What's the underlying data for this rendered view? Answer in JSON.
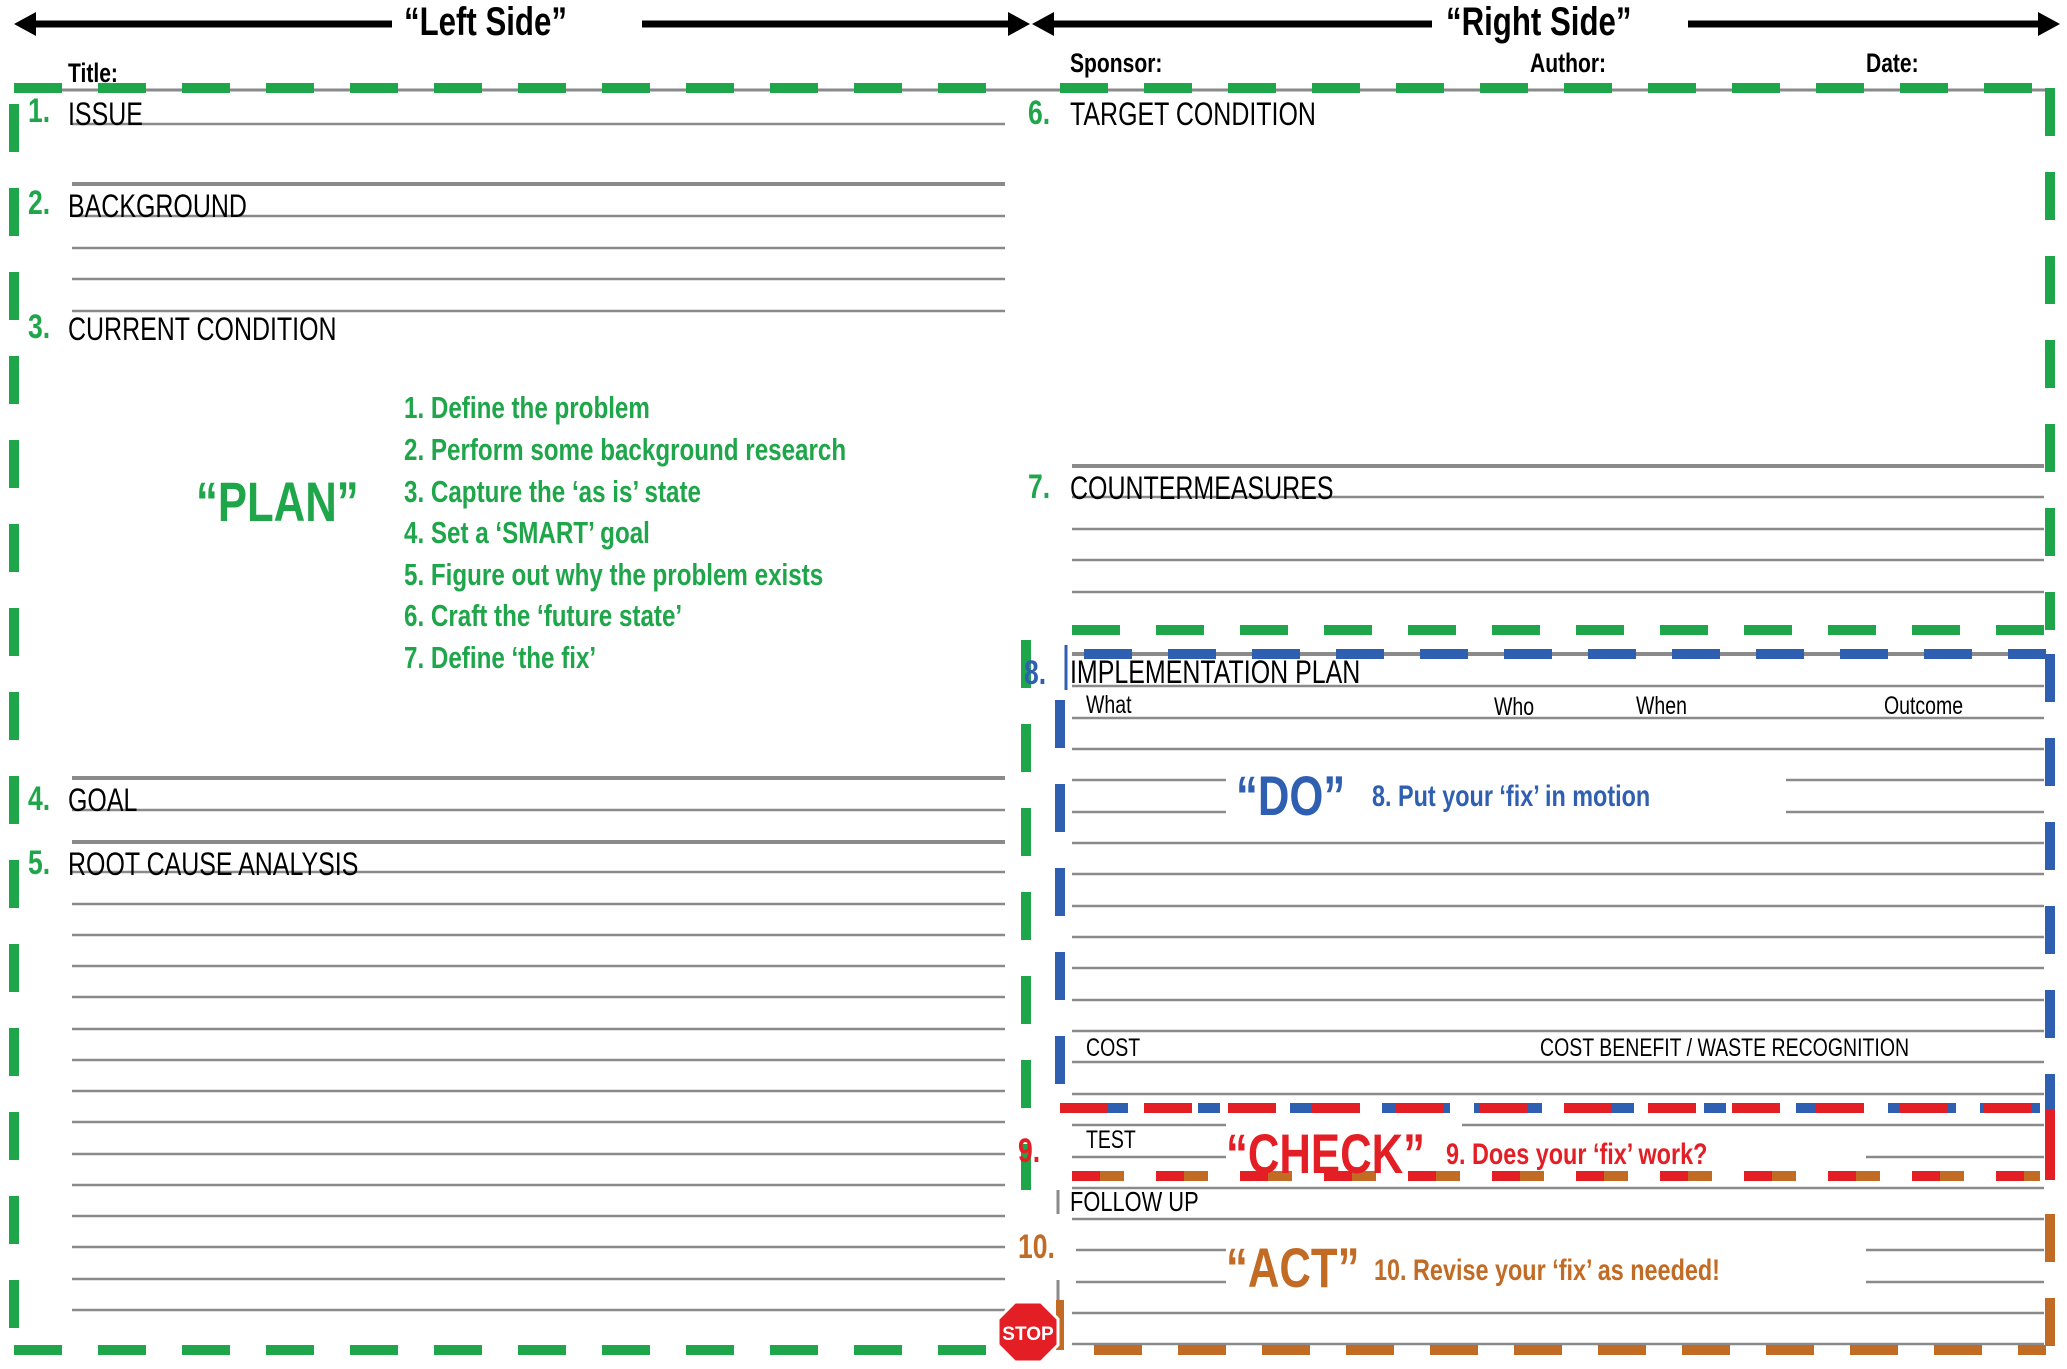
{
  "header": {
    "left_side_title": "“Left Side”",
    "right_side_title": "“Right Side”",
    "title_label": "Title:",
    "sponsor_label": "Sponsor:",
    "author_label": "Author:",
    "date_label": "Date:"
  },
  "colors": {
    "plan": "#1fa64a",
    "do": "#2f5fb0",
    "check": "#e31e24",
    "act": "#c26b25",
    "rule": "#8a8a8a",
    "text": "#000000"
  },
  "sections": [
    {
      "number": "1.",
      "label": "ISSUE",
      "phase": "plan"
    },
    {
      "number": "2.",
      "label": "BACKGROUND",
      "phase": "plan"
    },
    {
      "number": "3.",
      "label": "CURRENT CONDITION",
      "phase": "plan"
    },
    {
      "number": "4.",
      "label": "GOAL",
      "phase": "plan"
    },
    {
      "number": "5.",
      "label": "ROOT CAUSE ANALYSIS",
      "phase": "plan"
    },
    {
      "number": "6.",
      "label": "TARGET CONDITION",
      "phase": "plan"
    },
    {
      "number": "7.",
      "label": "COUNTERMEASURES",
      "phase": "plan"
    },
    {
      "number": "8.",
      "label": "IMPLEMENTATION PLAN",
      "phase": "do"
    },
    {
      "number": "9.",
      "label": "TEST",
      "phase": "check"
    },
    {
      "number": "10.",
      "label": "FOLLOW UP",
      "phase": "act"
    }
  ],
  "implementation_plan": {
    "columns": [
      "What",
      "Who",
      "When",
      "Outcome"
    ],
    "cost_label": "COST",
    "cost_benefit_label": "COST BENEFIT / WASTE RECOGNITION"
  },
  "phases": {
    "plan": {
      "title": "“PLAN”",
      "steps": [
        "1. Define the problem",
        "2. Perform some background research",
        "3. Capture the ‘as is’ state",
        "4. Set a ‘SMART’ goal",
        "5. Figure out why the problem exists",
        "6. Craft the ‘future state’",
        "7. Define ‘the fix’"
      ]
    },
    "do": {
      "title": "“DO”",
      "description": "8. Put your ‘fix’ in motion"
    },
    "check": {
      "title": "“CHECK”",
      "description": "9. Does your ‘fix’ work?"
    },
    "act": {
      "title": "“ACT”",
      "description": "10. Revise your ‘fix’ as needed!"
    }
  },
  "stop_sign": {
    "label": "STOP",
    "icon": "stop-sign-icon"
  }
}
